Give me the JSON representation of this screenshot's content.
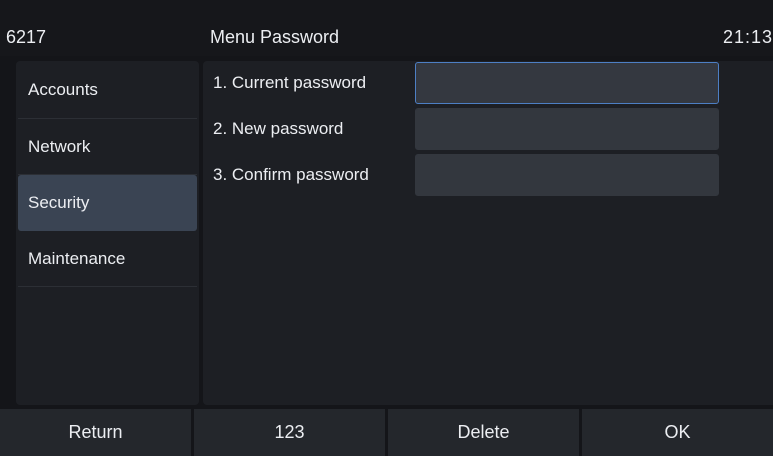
{
  "status_bar": {
    "extension": "6217",
    "title": "Menu Password",
    "time": "21:13"
  },
  "sidebar": {
    "items": [
      {
        "label": "Accounts",
        "active": false
      },
      {
        "label": "Network",
        "active": false
      },
      {
        "label": "Security",
        "active": true
      },
      {
        "label": "Maintenance",
        "active": false
      }
    ]
  },
  "form": {
    "fields": [
      {
        "label": "1. Current password",
        "value": "",
        "focused": true
      },
      {
        "label": "2. New password",
        "value": "",
        "focused": false
      },
      {
        "label": "3. Confirm password",
        "value": "",
        "focused": false
      }
    ]
  },
  "softkeys": {
    "return_label": "Return",
    "input_mode_label": "123",
    "delete_label": "Delete",
    "ok_label": "OK"
  },
  "colors": {
    "active_item": "#3a4453",
    "focus_border": "#4d7fc4"
  }
}
